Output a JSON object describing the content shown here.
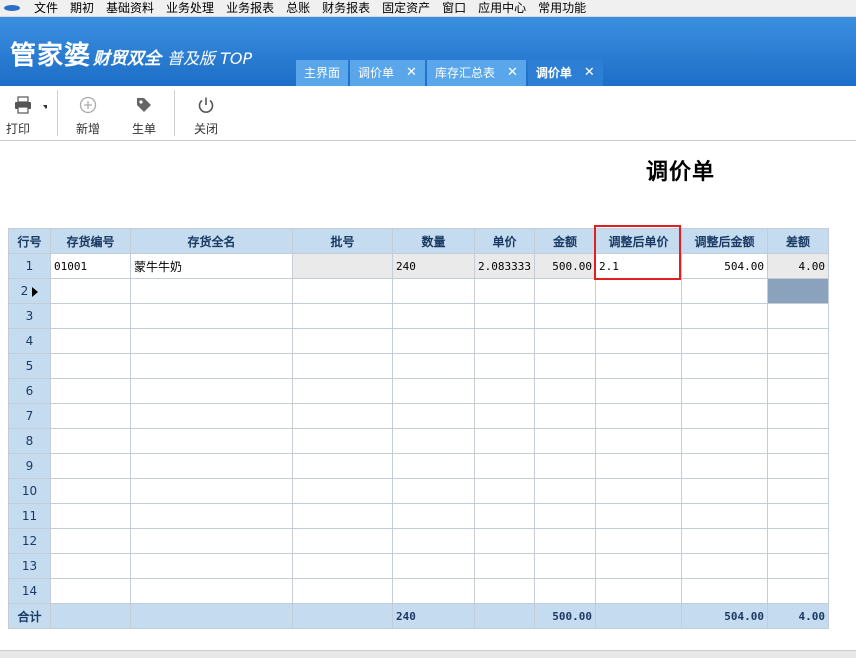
{
  "menubar": {
    "items": [
      "文件",
      "期初",
      "基础资料",
      "业务处理",
      "业务报表",
      "总账",
      "财务报表",
      "固定资产",
      "窗口",
      "应用中心",
      "常用功能"
    ]
  },
  "header": {
    "brand_main": "管家婆",
    "brand_sub": "财贸双全",
    "brand_edition": "普及版 TOP",
    "tabs": [
      {
        "label": "主界面",
        "closable": false,
        "active": false
      },
      {
        "label": "调价单",
        "closable": true,
        "active": false
      },
      {
        "label": "库存汇总表",
        "closable": true,
        "active": false
      },
      {
        "label": "调价单",
        "closable": true,
        "active": true
      }
    ],
    "close_glyph": "✕"
  },
  "toolbar": {
    "print": {
      "label": "打印",
      "icon": "printer-icon"
    },
    "add": {
      "label": "新增",
      "icon": "plus-circle-icon"
    },
    "generate": {
      "label": "生单",
      "icon": "tag-icon"
    },
    "close": {
      "label": "关闭",
      "icon": "power-icon"
    }
  },
  "document": {
    "title": "调价单"
  },
  "grid": {
    "headers": [
      "行号",
      "存货编号",
      "存货全名",
      "批号",
      "数量",
      "单价",
      "金额",
      "调整后单价",
      "调整后金额",
      "差额"
    ],
    "rows": [
      {
        "no": "1",
        "code": "01001",
        "name": "蒙牛牛奶",
        "batch": "",
        "qty": "240",
        "price": "2.083333",
        "amount": "500.00",
        "new_price": "2.1",
        "new_amount": "504.00",
        "diff": "4.00"
      },
      {
        "no": "2",
        "code": "",
        "name": "",
        "batch": "",
        "qty": "",
        "price": "",
        "amount": "",
        "new_price": "",
        "new_amount": "",
        "diff": ""
      },
      {
        "no": "3"
      },
      {
        "no": "4"
      },
      {
        "no": "5"
      },
      {
        "no": "6"
      },
      {
        "no": "7"
      },
      {
        "no": "8"
      },
      {
        "no": "9"
      },
      {
        "no": "10"
      },
      {
        "no": "11"
      },
      {
        "no": "12"
      },
      {
        "no": "13"
      },
      {
        "no": "14"
      }
    ],
    "total": {
      "label": "合计",
      "qty": "240",
      "amount": "500.00",
      "new_amount": "504.00",
      "diff": "4.00"
    }
  },
  "colors": {
    "header_blue": "#1d6ec7",
    "grid_header": "#c5dcf0",
    "highlight_box": "#e02020"
  }
}
